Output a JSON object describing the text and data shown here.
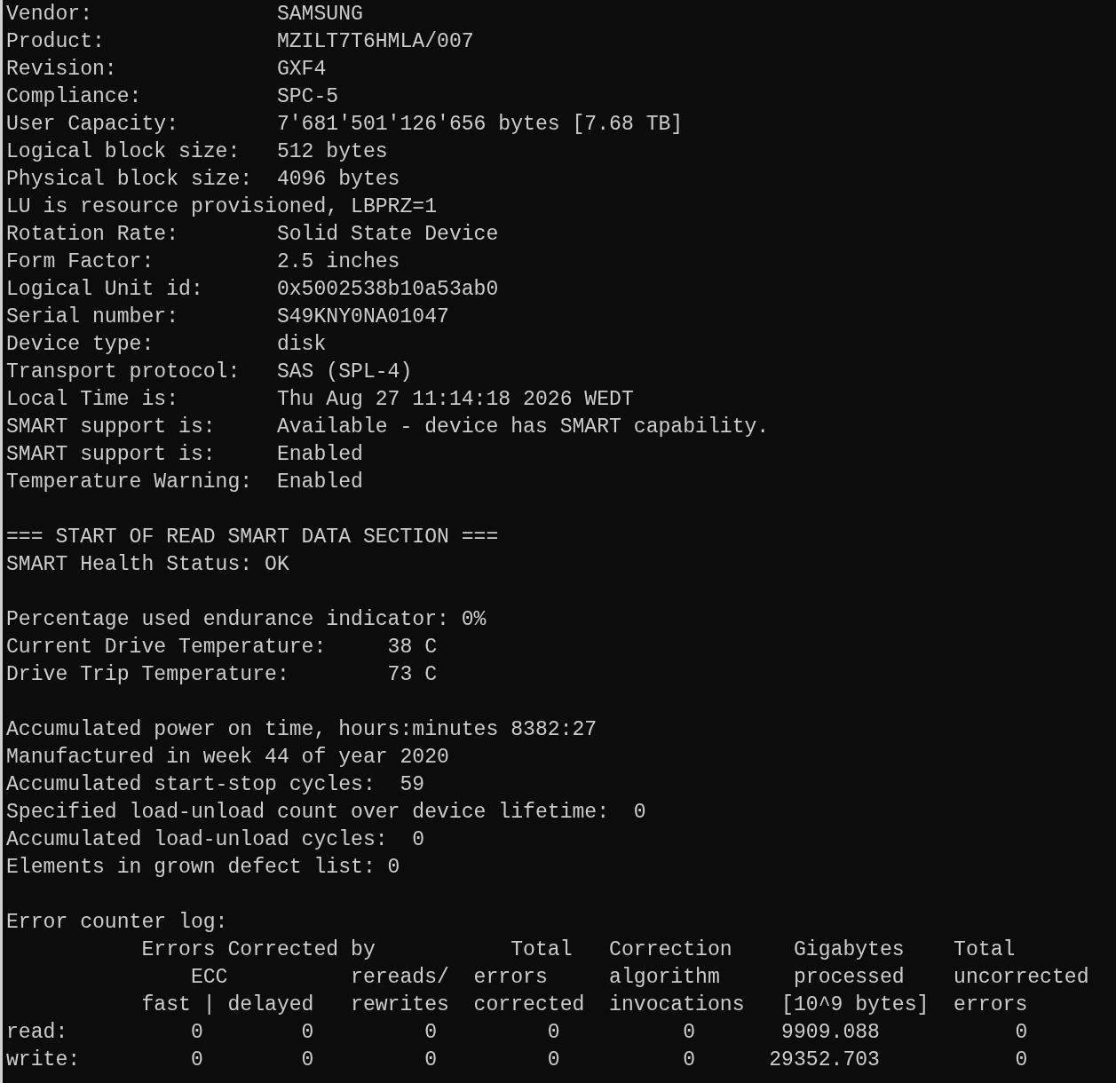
{
  "terminal": {
    "blocks": [
      {
        "lines": [
          "Vendor:               SAMSUNG",
          "Product:              MZILT7T6HMLA/007",
          "Revision:             GXF4",
          "Compliance:           SPC-5",
          "User Capacity:        7'681'501'126'656 bytes [7.68 TB]",
          "Logical block size:   512 bytes",
          "Physical block size:  4096 bytes",
          "LU is resource provisioned, LBPRZ=1",
          "Rotation Rate:        Solid State Device",
          "Form Factor:          2.5 inches",
          "Logical Unit id:      0x5002538b10a53ab0",
          "Serial number:        S49KNY0NA01047",
          "Device type:          disk",
          "Transport protocol:   SAS (SPL-4)",
          "Local Time is:        Thu Aug 27 11:14:18 2026 WEDT",
          "SMART support is:     Available - device has SMART capability.",
          "SMART support is:     Enabled",
          "Temperature Warning:  Enabled"
        ]
      },
      {
        "lines": [
          "=== START OF READ SMART DATA SECTION ===",
          "SMART Health Status: OK"
        ]
      },
      {
        "lines": [
          "Percentage used endurance indicator: 0%",
          "Current Drive Temperature:     38 C",
          "Drive Trip Temperature:        73 C"
        ]
      },
      {
        "lines": [
          "Accumulated power on time, hours:minutes 8382:27",
          "Manufactured in week 44 of year 2020",
          "Accumulated start-stop cycles:  59",
          "Specified load-unload count over device lifetime:  0",
          "Accumulated load-unload cycles:  0",
          "Elements in grown defect list: 0"
        ]
      },
      {
        "lines": [
          "Error counter log:",
          "           Errors Corrected by           Total   Correction     Gigabytes    Total",
          "               ECC          rereads/  errors     algorithm      processed    uncorrected",
          "           fast | delayed   rewrites  corrected  invocations   [10^9 bytes]  errors",
          "read:          0        0         0         0          0       9909.088           0",
          "write:         0        0         0         0          0      29352.703           0"
        ]
      }
    ]
  }
}
